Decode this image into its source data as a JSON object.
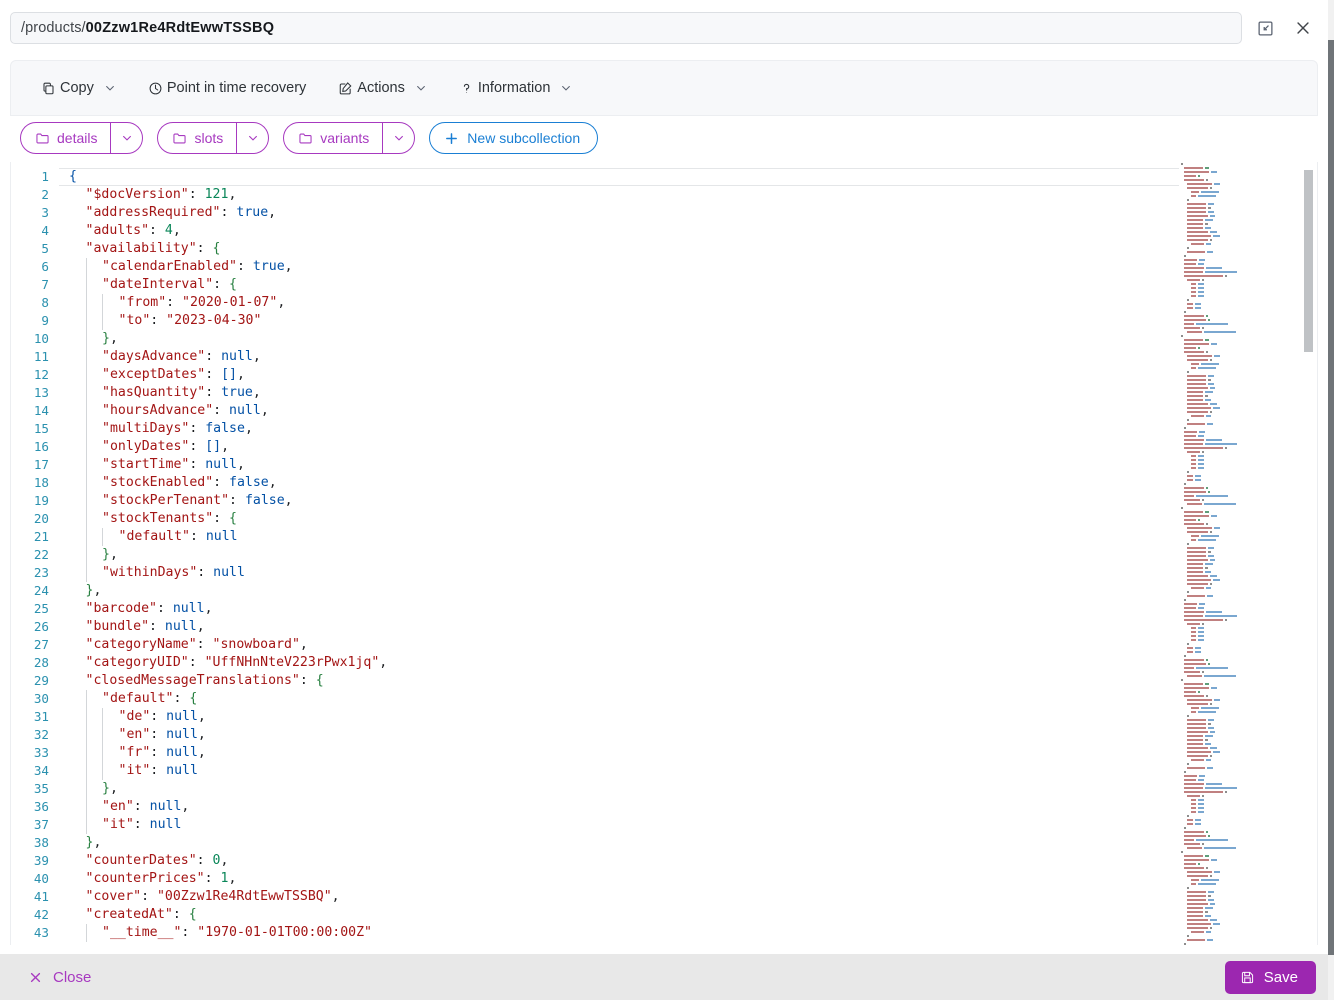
{
  "header": {
    "path_prefix": "/products/",
    "document_id": "00Zzw1Re4RdtEwwTSSBQ",
    "expand_icon": "collapse-window-icon",
    "close_icon": "close-icon"
  },
  "toolbar": {
    "items": [
      {
        "label": "Copy",
        "icon": "copy-icon",
        "has_caret": true
      },
      {
        "label": "Point in time recovery",
        "icon": "clock-icon",
        "has_caret": false
      },
      {
        "label": "Actions",
        "icon": "edit-square-icon",
        "has_caret": true
      },
      {
        "label": "Information",
        "icon": "question-mark-icon",
        "has_caret": true
      }
    ]
  },
  "subcollections": {
    "chips": [
      {
        "label": "details",
        "icon": "folder-icon",
        "caret": "chevron-down-icon"
      },
      {
        "label": "slots",
        "icon": "folder-icon",
        "caret": "chevron-down-icon"
      },
      {
        "label": "variants",
        "icon": "folder-icon",
        "caret": "chevron-down-icon"
      }
    ],
    "new_button": {
      "label": "New subcollection",
      "icon": "plus-icon"
    },
    "accent_purple": "#a739c0",
    "accent_blue": "#1a7fd4"
  },
  "editor": {
    "language": "json",
    "first_visible_line": 1,
    "last_visible_line": 43,
    "current_line": 1,
    "lines": [
      {
        "n": 1,
        "indent": 0,
        "tokens": [
          {
            "t": "brace",
            "v": "{"
          }
        ]
      },
      {
        "n": 2,
        "indent": 1,
        "tokens": [
          {
            "t": "key",
            "v": "\"$docVersion\""
          },
          {
            "t": "punc",
            "v": ": "
          },
          {
            "t": "num",
            "v": "121"
          },
          {
            "t": "punc",
            "v": ","
          }
        ]
      },
      {
        "n": 3,
        "indent": 1,
        "tokens": [
          {
            "t": "key",
            "v": "\"addressRequired\""
          },
          {
            "t": "punc",
            "v": ": "
          },
          {
            "t": "bool",
            "v": "true"
          },
          {
            "t": "punc",
            "v": ","
          }
        ]
      },
      {
        "n": 4,
        "indent": 1,
        "tokens": [
          {
            "t": "key",
            "v": "\"adults\""
          },
          {
            "t": "punc",
            "v": ": "
          },
          {
            "t": "num",
            "v": "4"
          },
          {
            "t": "punc",
            "v": ","
          }
        ]
      },
      {
        "n": 5,
        "indent": 1,
        "tokens": [
          {
            "t": "key",
            "v": "\"availability\""
          },
          {
            "t": "punc",
            "v": ": "
          },
          {
            "t": "brace-g",
            "v": "{"
          }
        ]
      },
      {
        "n": 6,
        "indent": 2,
        "tokens": [
          {
            "t": "key",
            "v": "\"calendarEnabled\""
          },
          {
            "t": "punc",
            "v": ": "
          },
          {
            "t": "bool",
            "v": "true"
          },
          {
            "t": "punc",
            "v": ","
          }
        ]
      },
      {
        "n": 7,
        "indent": 2,
        "tokens": [
          {
            "t": "key",
            "v": "\"dateInterval\""
          },
          {
            "t": "punc",
            "v": ": "
          },
          {
            "t": "brace-g",
            "v": "{"
          }
        ]
      },
      {
        "n": 8,
        "indent": 3,
        "tokens": [
          {
            "t": "key",
            "v": "\"from\""
          },
          {
            "t": "punc",
            "v": ": "
          },
          {
            "t": "str",
            "v": "\"2020-01-07\""
          },
          {
            "t": "punc",
            "v": ","
          }
        ]
      },
      {
        "n": 9,
        "indent": 3,
        "tokens": [
          {
            "t": "key",
            "v": "\"to\""
          },
          {
            "t": "punc",
            "v": ": "
          },
          {
            "t": "str",
            "v": "\"2023-04-30\""
          }
        ]
      },
      {
        "n": 10,
        "indent": 2,
        "tokens": [
          {
            "t": "brace-g",
            "v": "}"
          },
          {
            "t": "punc",
            "v": ","
          }
        ]
      },
      {
        "n": 11,
        "indent": 2,
        "tokens": [
          {
            "t": "key",
            "v": "\"daysAdvance\""
          },
          {
            "t": "punc",
            "v": ": "
          },
          {
            "t": "null",
            "v": "null"
          },
          {
            "t": "punc",
            "v": ","
          }
        ]
      },
      {
        "n": 12,
        "indent": 2,
        "tokens": [
          {
            "t": "key",
            "v": "\"exceptDates\""
          },
          {
            "t": "punc",
            "v": ": "
          },
          {
            "t": "brace",
            "v": "[]"
          },
          {
            "t": "punc",
            "v": ","
          }
        ]
      },
      {
        "n": 13,
        "indent": 2,
        "tokens": [
          {
            "t": "key",
            "v": "\"hasQuantity\""
          },
          {
            "t": "punc",
            "v": ": "
          },
          {
            "t": "bool",
            "v": "true"
          },
          {
            "t": "punc",
            "v": ","
          }
        ]
      },
      {
        "n": 14,
        "indent": 2,
        "tokens": [
          {
            "t": "key",
            "v": "\"hoursAdvance\""
          },
          {
            "t": "punc",
            "v": ": "
          },
          {
            "t": "null",
            "v": "null"
          },
          {
            "t": "punc",
            "v": ","
          }
        ]
      },
      {
        "n": 15,
        "indent": 2,
        "tokens": [
          {
            "t": "key",
            "v": "\"multiDays\""
          },
          {
            "t": "punc",
            "v": ": "
          },
          {
            "t": "bool",
            "v": "false"
          },
          {
            "t": "punc",
            "v": ","
          }
        ]
      },
      {
        "n": 16,
        "indent": 2,
        "tokens": [
          {
            "t": "key",
            "v": "\"onlyDates\""
          },
          {
            "t": "punc",
            "v": ": "
          },
          {
            "t": "brace",
            "v": "[]"
          },
          {
            "t": "punc",
            "v": ","
          }
        ]
      },
      {
        "n": 17,
        "indent": 2,
        "tokens": [
          {
            "t": "key",
            "v": "\"startTime\""
          },
          {
            "t": "punc",
            "v": ": "
          },
          {
            "t": "null",
            "v": "null"
          },
          {
            "t": "punc",
            "v": ","
          }
        ]
      },
      {
        "n": 18,
        "indent": 2,
        "tokens": [
          {
            "t": "key",
            "v": "\"stockEnabled\""
          },
          {
            "t": "punc",
            "v": ": "
          },
          {
            "t": "bool",
            "v": "false"
          },
          {
            "t": "punc",
            "v": ","
          }
        ]
      },
      {
        "n": 19,
        "indent": 2,
        "tokens": [
          {
            "t": "key",
            "v": "\"stockPerTenant\""
          },
          {
            "t": "punc",
            "v": ": "
          },
          {
            "t": "bool",
            "v": "false"
          },
          {
            "t": "punc",
            "v": ","
          }
        ]
      },
      {
        "n": 20,
        "indent": 2,
        "tokens": [
          {
            "t": "key",
            "v": "\"stockTenants\""
          },
          {
            "t": "punc",
            "v": ": "
          },
          {
            "t": "brace-g",
            "v": "{"
          }
        ]
      },
      {
        "n": 21,
        "indent": 3,
        "tokens": [
          {
            "t": "key",
            "v": "\"default\""
          },
          {
            "t": "punc",
            "v": ": "
          },
          {
            "t": "null",
            "v": "null"
          }
        ]
      },
      {
        "n": 22,
        "indent": 2,
        "tokens": [
          {
            "t": "brace-g",
            "v": "}"
          },
          {
            "t": "punc",
            "v": ","
          }
        ]
      },
      {
        "n": 23,
        "indent": 2,
        "tokens": [
          {
            "t": "key",
            "v": "\"withinDays\""
          },
          {
            "t": "punc",
            "v": ": "
          },
          {
            "t": "null",
            "v": "null"
          }
        ]
      },
      {
        "n": 24,
        "indent": 1,
        "tokens": [
          {
            "t": "brace-g",
            "v": "}"
          },
          {
            "t": "punc",
            "v": ","
          }
        ]
      },
      {
        "n": 25,
        "indent": 1,
        "tokens": [
          {
            "t": "key",
            "v": "\"barcode\""
          },
          {
            "t": "punc",
            "v": ": "
          },
          {
            "t": "null",
            "v": "null"
          },
          {
            "t": "punc",
            "v": ","
          }
        ]
      },
      {
        "n": 26,
        "indent": 1,
        "tokens": [
          {
            "t": "key",
            "v": "\"bundle\""
          },
          {
            "t": "punc",
            "v": ": "
          },
          {
            "t": "null",
            "v": "null"
          },
          {
            "t": "punc",
            "v": ","
          }
        ]
      },
      {
        "n": 27,
        "indent": 1,
        "tokens": [
          {
            "t": "key",
            "v": "\"categoryName\""
          },
          {
            "t": "punc",
            "v": ": "
          },
          {
            "t": "str",
            "v": "\"snowboard\""
          },
          {
            "t": "punc",
            "v": ","
          }
        ]
      },
      {
        "n": 28,
        "indent": 1,
        "tokens": [
          {
            "t": "key",
            "v": "\"categoryUID\""
          },
          {
            "t": "punc",
            "v": ": "
          },
          {
            "t": "str",
            "v": "\"UffNHnNteV223rPwx1jq\""
          },
          {
            "t": "punc",
            "v": ","
          }
        ]
      },
      {
        "n": 29,
        "indent": 1,
        "tokens": [
          {
            "t": "key",
            "v": "\"closedMessageTranslations\""
          },
          {
            "t": "punc",
            "v": ": "
          },
          {
            "t": "brace-g",
            "v": "{"
          }
        ]
      },
      {
        "n": 30,
        "indent": 2,
        "tokens": [
          {
            "t": "key",
            "v": "\"default\""
          },
          {
            "t": "punc",
            "v": ": "
          },
          {
            "t": "brace-g",
            "v": "{"
          }
        ]
      },
      {
        "n": 31,
        "indent": 3,
        "tokens": [
          {
            "t": "key",
            "v": "\"de\""
          },
          {
            "t": "punc",
            "v": ": "
          },
          {
            "t": "null",
            "v": "null"
          },
          {
            "t": "punc",
            "v": ","
          }
        ]
      },
      {
        "n": 32,
        "indent": 3,
        "tokens": [
          {
            "t": "key",
            "v": "\"en\""
          },
          {
            "t": "punc",
            "v": ": "
          },
          {
            "t": "null",
            "v": "null"
          },
          {
            "t": "punc",
            "v": ","
          }
        ]
      },
      {
        "n": 33,
        "indent": 3,
        "tokens": [
          {
            "t": "key",
            "v": "\"fr\""
          },
          {
            "t": "punc",
            "v": ": "
          },
          {
            "t": "null",
            "v": "null"
          },
          {
            "t": "punc",
            "v": ","
          }
        ]
      },
      {
        "n": 34,
        "indent": 3,
        "tokens": [
          {
            "t": "key",
            "v": "\"it\""
          },
          {
            "t": "punc",
            "v": ": "
          },
          {
            "t": "null",
            "v": "null"
          }
        ]
      },
      {
        "n": 35,
        "indent": 2,
        "tokens": [
          {
            "t": "brace-g",
            "v": "}"
          },
          {
            "t": "punc",
            "v": ","
          }
        ]
      },
      {
        "n": 36,
        "indent": 2,
        "tokens": [
          {
            "t": "key",
            "v": "\"en\""
          },
          {
            "t": "punc",
            "v": ": "
          },
          {
            "t": "null",
            "v": "null"
          },
          {
            "t": "punc",
            "v": ","
          }
        ]
      },
      {
        "n": 37,
        "indent": 2,
        "tokens": [
          {
            "t": "key",
            "v": "\"it\""
          },
          {
            "t": "punc",
            "v": ": "
          },
          {
            "t": "null",
            "v": "null"
          }
        ]
      },
      {
        "n": 38,
        "indent": 1,
        "tokens": [
          {
            "t": "brace-g",
            "v": "}"
          },
          {
            "t": "punc",
            "v": ","
          }
        ]
      },
      {
        "n": 39,
        "indent": 1,
        "tokens": [
          {
            "t": "key",
            "v": "\"counterDates\""
          },
          {
            "t": "punc",
            "v": ": "
          },
          {
            "t": "num",
            "v": "0"
          },
          {
            "t": "punc",
            "v": ","
          }
        ]
      },
      {
        "n": 40,
        "indent": 1,
        "tokens": [
          {
            "t": "key",
            "v": "\"counterPrices\""
          },
          {
            "t": "punc",
            "v": ": "
          },
          {
            "t": "num",
            "v": "1"
          },
          {
            "t": "punc",
            "v": ","
          }
        ]
      },
      {
        "n": 41,
        "indent": 1,
        "tokens": [
          {
            "t": "key",
            "v": "\"cover\""
          },
          {
            "t": "punc",
            "v": ": "
          },
          {
            "t": "str",
            "v": "\"00Zzw1Re4RdtEwwTSSBQ\""
          },
          {
            "t": "punc",
            "v": ","
          }
        ]
      },
      {
        "n": 42,
        "indent": 1,
        "tokens": [
          {
            "t": "key",
            "v": "\"createdAt\""
          },
          {
            "t": "punc",
            "v": ": "
          },
          {
            "t": "brace-g",
            "v": "{"
          }
        ]
      },
      {
        "n": 43,
        "indent": 2,
        "tokens": [
          {
            "t": "key",
            "v": "\"__time__\""
          },
          {
            "t": "punc",
            "v": ": "
          },
          {
            "t": "str",
            "v": "\"1970-01-01T00:00:00Z\""
          }
        ]
      }
    ]
  },
  "footer": {
    "close_label": "Close",
    "close_icon": "close-x-icon",
    "save_label": "Save",
    "save_icon": "floppy-disk-icon",
    "save_color": "#9c27b0"
  }
}
